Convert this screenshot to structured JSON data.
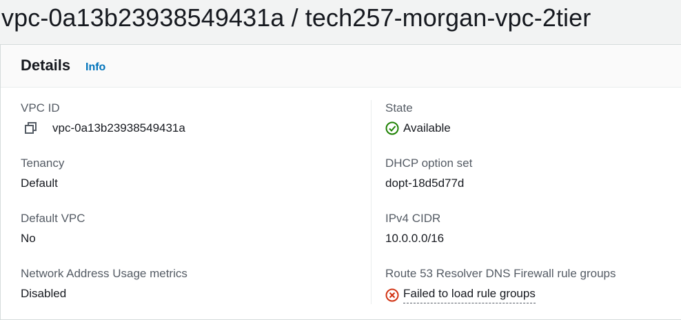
{
  "page": {
    "title": "vpc-0a13b23938549431a / tech257-morgan-vpc-2tier"
  },
  "details": {
    "title": "Details",
    "info_label": "Info",
    "left": {
      "vpc_id": {
        "label": "VPC ID",
        "value": "vpc-0a13b23938549431a"
      },
      "tenancy": {
        "label": "Tenancy",
        "value": "Default"
      },
      "default_vpc": {
        "label": "Default VPC",
        "value": "No"
      },
      "nau_metrics": {
        "label": "Network Address Usage metrics",
        "value": "Disabled"
      }
    },
    "right": {
      "state": {
        "label": "State",
        "value": "Available"
      },
      "dhcp": {
        "label": "DHCP option set",
        "value": "dopt-18d5d77d"
      },
      "ipv4": {
        "label": "IPv4 CIDR",
        "value": "10.0.0.0/16"
      },
      "route53": {
        "label": "Route 53 Resolver DNS Firewall rule groups",
        "value": "Failed to load rule groups"
      }
    }
  },
  "colors": {
    "success": "#1d8102",
    "error": "#d13212",
    "link": "#0073bb"
  },
  "icons": {
    "copy": "copy-icon",
    "success": "check-circle-icon",
    "error": "x-circle-icon"
  }
}
